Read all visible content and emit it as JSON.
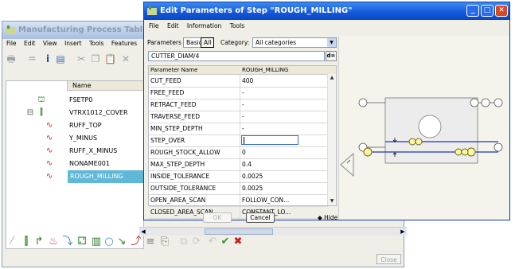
{
  "mpt": {
    "title": "Manufacturing Process Table",
    "menu": [
      "File",
      "Edit",
      "View",
      "Insert",
      "Tools",
      "Features"
    ],
    "tree_header": "Name",
    "tree_items": [
      {
        "name": "FSETP0",
        "icon": "fixture-setup-icon"
      },
      {
        "name": "VTRX1012_COVER",
        "icon": "workpiece-icon"
      },
      {
        "name": "RUFF_TOP",
        "icon": "step-icon"
      },
      {
        "name": "Y_MINUS",
        "icon": "step-icon"
      },
      {
        "name": "RUFF_X_MINUS",
        "icon": "step-icon"
      },
      {
        "name": "NONAME001",
        "icon": "step-icon"
      },
      {
        "name": "ROUGH_MILLING",
        "icon": "step-icon",
        "selected": true
      }
    ],
    "close_label": "Close"
  },
  "dialog": {
    "title": "Edit Parameters of Step \"ROUGH_MILLING\"",
    "menu": [
      "File",
      "Edit",
      "Information",
      "Tools"
    ],
    "parameters_label": "Parameters",
    "tab_basic": "Basic",
    "tab_all": "All",
    "category_label": "Category:",
    "category_value": "All categories",
    "formula_value": "CUTTER_DIAM/4",
    "formula_button": "d=",
    "col_name": "Parameter Name",
    "col_value": "ROUGH_MILLING",
    "rows": [
      {
        "name": "CUT_FEED",
        "value": "400"
      },
      {
        "name": "FREE_FEED",
        "value": "-"
      },
      {
        "name": "RETRACT_FEED",
        "value": "-"
      },
      {
        "name": "TRAVERSE_FEED",
        "value": "-"
      },
      {
        "name": "MIN_STEP_DEPTH",
        "value": "-"
      },
      {
        "name": "STEP_OVER",
        "value": "",
        "editing": true
      },
      {
        "name": "ROUGH_STOCK_ALLOW",
        "value": "0"
      },
      {
        "name": "MAX_STEP_DEPTH",
        "value": "0.4"
      },
      {
        "name": "INSIDE_TOLERANCE",
        "value": "0.0025"
      },
      {
        "name": "OUTSIDE_TOLERANCE",
        "value": "0.0025"
      },
      {
        "name": "OPEN_AREA_SCAN",
        "value": "FOLLOW_CON..."
      },
      {
        "name": "CLOSED_AREA_SCAN",
        "value": "CONSTANT_LO..."
      }
    ],
    "ok_label": "OK",
    "cancel_label": "Cancel",
    "hide_details_label": "Hide Details"
  },
  "colors": {
    "title_active": "#1257d8",
    "selection": "#5fb8d8",
    "check_green": "#2a9a2a",
    "delete_red": "#cc1a1a"
  }
}
